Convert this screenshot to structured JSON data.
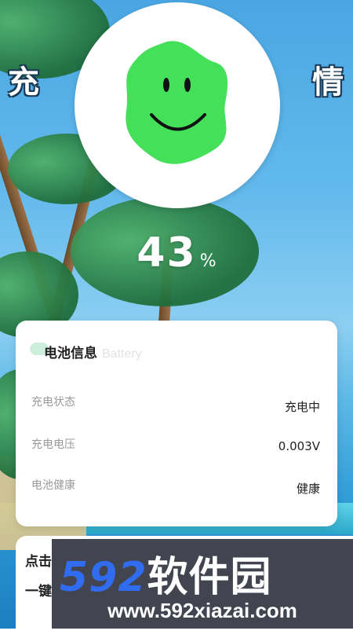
{
  "side_chars": {
    "left": "充",
    "right": "情"
  },
  "battery": {
    "percent": "43",
    "percent_symbol": "%"
  },
  "card": {
    "title": "电池信息",
    "ghost_text": "Battery",
    "rows": [
      {
        "label": "充电状态",
        "value": "充电中"
      },
      {
        "label": "充电电压",
        "value": "0.003V"
      },
      {
        "label": "电池健康",
        "value": "健康"
      }
    ]
  },
  "bottom": {
    "line1": "点击",
    "line2": "一键"
  },
  "watermark": {
    "number": "592",
    "text": "软件园",
    "url": "www.592xiazai.com"
  },
  "colors": {
    "accent_green": "#44e05a",
    "watermark_blue": "#2f6cf0"
  },
  "icons": {
    "mascot": "smiley-blob-icon"
  }
}
